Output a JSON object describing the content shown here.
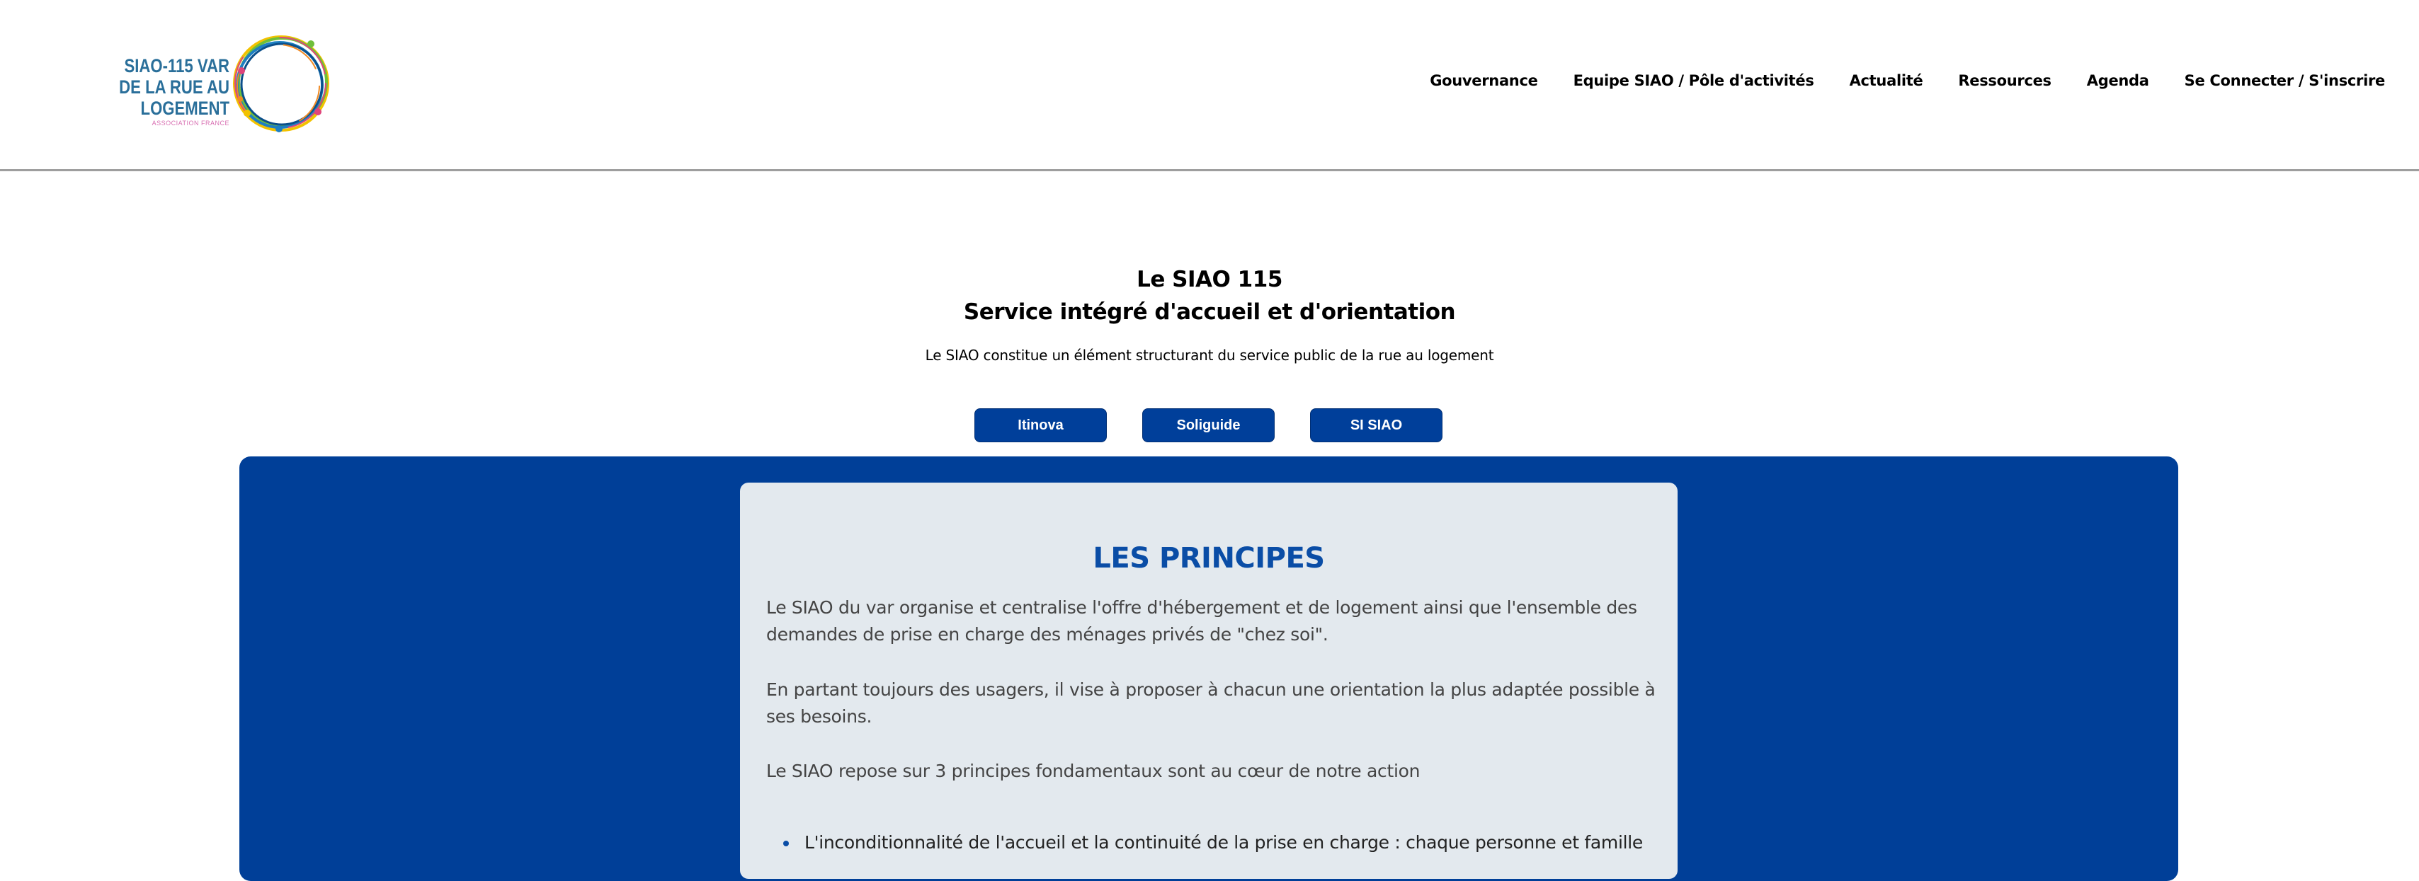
{
  "header": {
    "logo": {
      "line1": "SIAO-115 VAR",
      "line2": "DE LA RUE AU LOGEMENT",
      "line3": "ASSOCIATION FRANCE"
    },
    "nav": [
      {
        "label": "Gouvernance"
      },
      {
        "label": "Equipe SIAO / Pôle d'activités"
      },
      {
        "label": "Actualité"
      },
      {
        "label": "Ressources"
      },
      {
        "label": "Agenda"
      },
      {
        "label": "Se Connecter / S'inscrire"
      }
    ]
  },
  "hero": {
    "title_line1": "Le SIAO 115",
    "title_line2": "Service intégré d'accueil et d'orientation",
    "subtitle": "Le SIAO constitue un élément structurant du service public de la rue au logement",
    "buttons": [
      {
        "label": "Itinova"
      },
      {
        "label": "Soliguide"
      },
      {
        "label": "SI SIAO"
      }
    ]
  },
  "principles": {
    "title": "LES PRINCIPES",
    "paragraph1": "Le SIAO du var organise et centralise l'offre d'hébergement et de logement ainsi que l'ensemble des demandes de prise en charge des ménages privés de \"chez soi\".",
    "paragraph2": "En partant toujours des usagers, il vise à proposer à chacun une orientation la plus adaptée possible à ses besoins.",
    "paragraph3": "Le SIAO repose sur 3 principes fondamentaux sont au cœur de notre action",
    "bullet1": "L'inconditionnalité de l'accueil et la continuité de la prise en charge : chaque personne et famille"
  },
  "colors": {
    "brand_blue": "#003f98",
    "card_bg": "#e3e9ee",
    "title_blue": "#0a4da6"
  }
}
